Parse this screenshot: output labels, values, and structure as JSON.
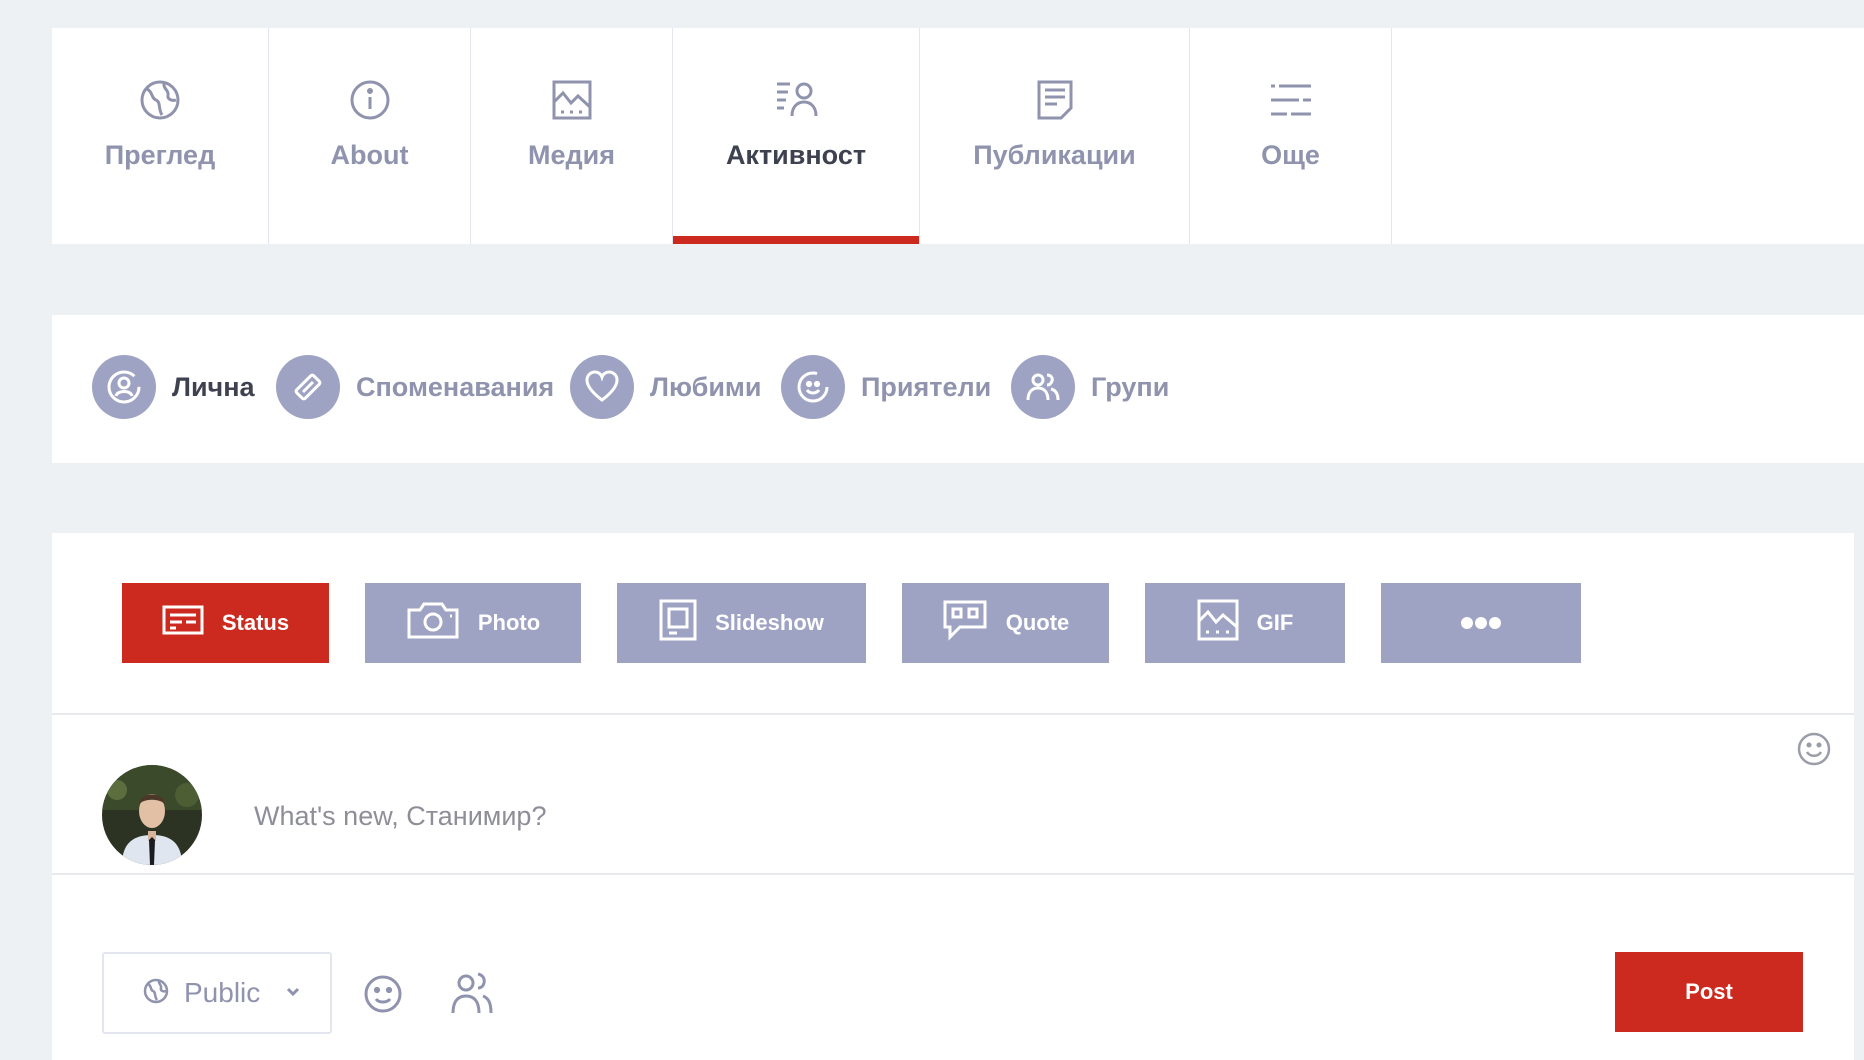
{
  "profile_tabs": [
    {
      "label": "Преглед",
      "icon": "globe-icon"
    },
    {
      "label": "About",
      "icon": "info-icon"
    },
    {
      "label": "Медия",
      "icon": "gallery-icon"
    },
    {
      "label": "Активност",
      "icon": "activity-icon",
      "active": true
    },
    {
      "label": "Публикации",
      "icon": "document-icon"
    },
    {
      "label": "Още",
      "icon": "more-lines-icon"
    }
  ],
  "activity_filters": [
    {
      "label": "Лична",
      "icon": "personal-icon",
      "active": true
    },
    {
      "label": "Споменавания",
      "icon": "mention-icon"
    },
    {
      "label": "Любими",
      "icon": "heart-icon"
    },
    {
      "label": "Приятели",
      "icon": "friends-icon"
    },
    {
      "label": "Групи",
      "icon": "groups-icon"
    }
  ],
  "post_types": [
    {
      "label": "Status",
      "icon": "status-icon",
      "active": true
    },
    {
      "label": "Photo",
      "icon": "camera-icon"
    },
    {
      "label": "Slideshow",
      "icon": "slideshow-icon"
    },
    {
      "label": "Quote",
      "icon": "quote-icon"
    },
    {
      "label": "GIF",
      "icon": "gif-icon"
    },
    {
      "label": "",
      "icon": "ellipsis-icon"
    }
  ],
  "composer": {
    "placeholder": "What's new, Станимир?",
    "privacy_label": "Public",
    "post_label": "Post"
  },
  "colors": {
    "accent": "#cd2a1f",
    "muted": "#9fa3c3",
    "text_muted": "#8f93ad",
    "text_active": "#3e4150",
    "background": "#eef1f4"
  }
}
